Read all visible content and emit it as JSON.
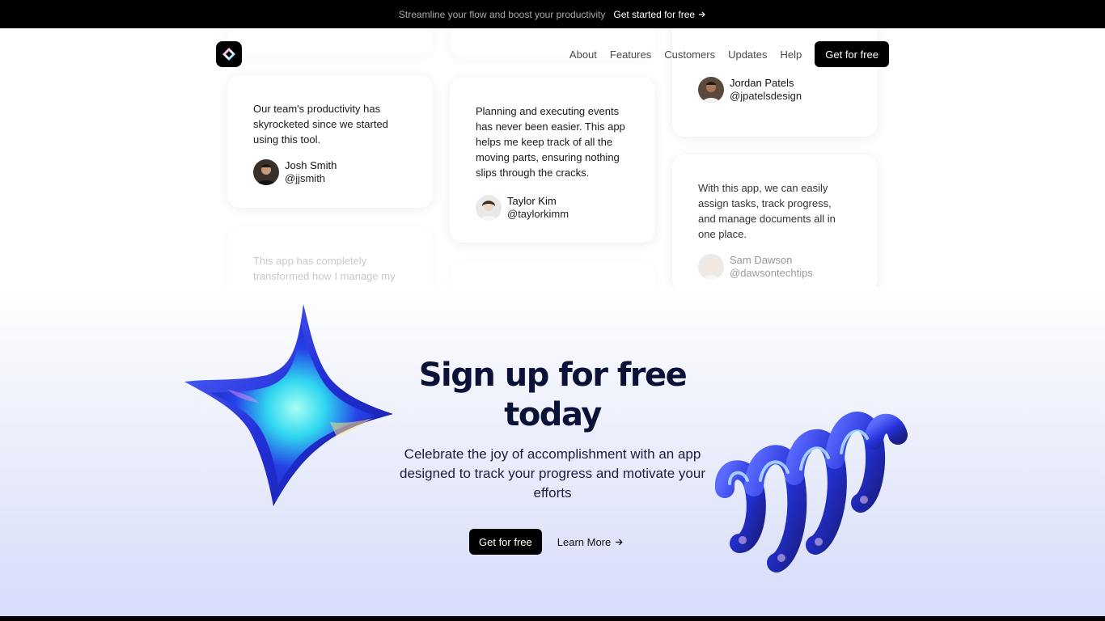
{
  "announcement": {
    "message": "Streamline your flow and boost your productivity",
    "cta_label": "Get started for free",
    "arrow_icon": "arrow-right-icon"
  },
  "nav": {
    "logo_icon": "app-logo-icon",
    "links": [
      "About",
      "Features",
      "Customers",
      "Updates",
      "Help"
    ],
    "cta_label": "Get for free"
  },
  "testimonials": [
    {
      "quote": "Our team's productivity has skyrocketed since we started using this tool.",
      "name": "Josh Smith",
      "handle": "@jjsmith"
    },
    {
      "quote": "Planning and executing events has never been easier. This app helps me keep track of all the moving parts, ensuring nothing slips through the cracks.",
      "name": "Taylor Kim",
      "handle": "@taylorkimm"
    },
    {
      "quote": "",
      "name": "Jordan Patels",
      "handle": "@jpatelsdesign"
    },
    {
      "quote": "With this app, we can easily assign tasks, track progress, and manage documents all in one place.",
      "name": "Sam Dawson",
      "handle": "@dawsontechtips"
    },
    {
      "quote": "This app has completely transformed how I manage my",
      "name": "",
      "handle": ""
    }
  ],
  "signup": {
    "headline_line1": "Sign up for free",
    "headline_line2": "today",
    "subtext": "Celebrate the joy of accomplishment with an app designed to track your progress and motivate your efforts",
    "primary_label": "Get for free",
    "secondary_label": "Learn More"
  },
  "colors": {
    "accent": "#000000",
    "headline": "#0b1238",
    "shape_blue": "#2d3be0",
    "bg_gradient_end": "#d6dcfa"
  }
}
